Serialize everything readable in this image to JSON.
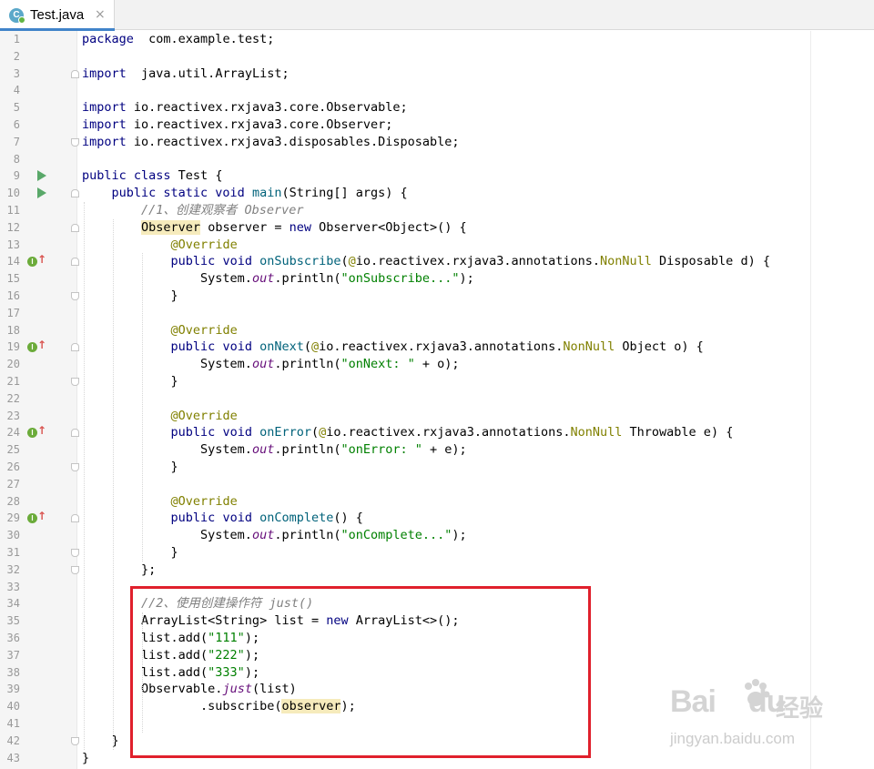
{
  "tab": {
    "title": "Test.java",
    "icon": "java-class-icon",
    "close": "×"
  },
  "lines": [
    {
      "n": "1",
      "parts": [
        [
          "kw",
          "package"
        ],
        [
          "",
          "  com.example.test;"
        ]
      ]
    },
    {
      "n": "2",
      "parts": []
    },
    {
      "n": "3",
      "parts": [
        [
          "kw",
          "import"
        ],
        [
          "",
          "  java.util.ArrayList;"
        ]
      ]
    },
    {
      "n": "4",
      "parts": []
    },
    {
      "n": "5",
      "parts": [
        [
          "kw",
          "import"
        ],
        [
          "",
          " io.reactivex.rxjava3.core.Observable;"
        ]
      ]
    },
    {
      "n": "6",
      "parts": [
        [
          "kw",
          "import"
        ],
        [
          "",
          " io.reactivex.rxjava3.core.Observer;"
        ]
      ]
    },
    {
      "n": "7",
      "parts": [
        [
          "kw",
          "import"
        ],
        [
          "",
          " io.reactivex.rxjava3.disposables.Disposable;"
        ]
      ]
    },
    {
      "n": "8",
      "parts": []
    },
    {
      "n": "9",
      "parts": [
        [
          "kw",
          "public class"
        ],
        [
          "",
          " Test {"
        ]
      ]
    },
    {
      "n": "10",
      "parts": [
        [
          "",
          "    "
        ],
        [
          "kw",
          "public static void"
        ],
        [
          "",
          " "
        ],
        [
          "fn",
          "main"
        ],
        [
          "",
          "(String[] args) {"
        ]
      ]
    },
    {
      "n": "11",
      "parts": [
        [
          "",
          "        "
        ],
        [
          "cm",
          "//1、创建观察者 Observer"
        ]
      ]
    },
    {
      "n": "12",
      "parts": [
        [
          "",
          "        "
        ],
        [
          "hl",
          "Observer"
        ],
        [
          "",
          " observer = "
        ],
        [
          "kw",
          "new"
        ],
        [
          "",
          " Observer<Object>() {"
        ]
      ]
    },
    {
      "n": "13",
      "parts": [
        [
          "",
          "            "
        ],
        [
          "ann",
          "@Override"
        ]
      ]
    },
    {
      "n": "14",
      "parts": [
        [
          "",
          "            "
        ],
        [
          "kw",
          "public void"
        ],
        [
          "",
          " "
        ],
        [
          "fn",
          "onSubscribe"
        ],
        [
          "",
          "("
        ],
        [
          "ann",
          "@"
        ],
        [
          "",
          "io.reactivex.rxjava3.annotations."
        ],
        [
          "ann",
          "NonNull"
        ],
        [
          "",
          " Disposable d) {"
        ]
      ]
    },
    {
      "n": "15",
      "parts": [
        [
          "",
          "                System."
        ],
        [
          "st",
          "out"
        ],
        [
          "",
          ".println("
        ],
        [
          "str",
          "\"onSubscribe...\""
        ],
        [
          "",
          ");"
        ]
      ]
    },
    {
      "n": "16",
      "parts": [
        [
          "",
          "            }"
        ]
      ]
    },
    {
      "n": "17",
      "parts": []
    },
    {
      "n": "18",
      "parts": [
        [
          "",
          "            "
        ],
        [
          "ann",
          "@Override"
        ]
      ]
    },
    {
      "n": "19",
      "parts": [
        [
          "",
          "            "
        ],
        [
          "kw",
          "public void"
        ],
        [
          "",
          " "
        ],
        [
          "fn",
          "onNext"
        ],
        [
          "",
          "("
        ],
        [
          "ann",
          "@"
        ],
        [
          "",
          "io.reactivex.rxjava3.annotations."
        ],
        [
          "ann",
          "NonNull"
        ],
        [
          "",
          " Object o) {"
        ]
      ]
    },
    {
      "n": "20",
      "parts": [
        [
          "",
          "                System."
        ],
        [
          "st",
          "out"
        ],
        [
          "",
          ".println("
        ],
        [
          "str",
          "\"onNext: \""
        ],
        [
          "",
          " + o);"
        ]
      ]
    },
    {
      "n": "21",
      "parts": [
        [
          "",
          "            }"
        ]
      ]
    },
    {
      "n": "22",
      "parts": []
    },
    {
      "n": "23",
      "parts": [
        [
          "",
          "            "
        ],
        [
          "ann",
          "@Override"
        ]
      ]
    },
    {
      "n": "24",
      "parts": [
        [
          "",
          "            "
        ],
        [
          "kw",
          "public void"
        ],
        [
          "",
          " "
        ],
        [
          "fn",
          "onError"
        ],
        [
          "",
          "("
        ],
        [
          "ann",
          "@"
        ],
        [
          "",
          "io.reactivex.rxjava3.annotations."
        ],
        [
          "ann",
          "NonNull"
        ],
        [
          "",
          " Throwable e) {"
        ]
      ]
    },
    {
      "n": "25",
      "parts": [
        [
          "",
          "                System."
        ],
        [
          "st",
          "out"
        ],
        [
          "",
          ".println("
        ],
        [
          "str",
          "\"onError: \""
        ],
        [
          "",
          " + e);"
        ]
      ]
    },
    {
      "n": "26",
      "parts": [
        [
          "",
          "            }"
        ]
      ]
    },
    {
      "n": "27",
      "parts": []
    },
    {
      "n": "28",
      "parts": [
        [
          "",
          "            "
        ],
        [
          "ann",
          "@Override"
        ]
      ]
    },
    {
      "n": "29",
      "parts": [
        [
          "",
          "            "
        ],
        [
          "kw",
          "public void"
        ],
        [
          "",
          " "
        ],
        [
          "fn",
          "onComplete"
        ],
        [
          "",
          "() {"
        ]
      ]
    },
    {
      "n": "30",
      "parts": [
        [
          "",
          "                System."
        ],
        [
          "st",
          "out"
        ],
        [
          "",
          ".println("
        ],
        [
          "str",
          "\"onComplete...\""
        ],
        [
          "",
          ");"
        ]
      ]
    },
    {
      "n": "31",
      "parts": [
        [
          "",
          "            }"
        ]
      ]
    },
    {
      "n": "32",
      "parts": [
        [
          "",
          "        };"
        ]
      ]
    },
    {
      "n": "33",
      "parts": []
    },
    {
      "n": "34",
      "parts": [
        [
          "",
          "        "
        ],
        [
          "cm",
          "//2、使用创建操作符 just()"
        ]
      ]
    },
    {
      "n": "35",
      "parts": [
        [
          "",
          "        ArrayList<String> list = "
        ],
        [
          "kw",
          "new"
        ],
        [
          "",
          " ArrayList<>();"
        ]
      ]
    },
    {
      "n": "36",
      "parts": [
        [
          "",
          "        list.add("
        ],
        [
          "str",
          "\"111\""
        ],
        [
          "",
          ");"
        ]
      ]
    },
    {
      "n": "37",
      "parts": [
        [
          "",
          "        list.add("
        ],
        [
          "str",
          "\"222\""
        ],
        [
          "",
          ");"
        ]
      ]
    },
    {
      "n": "38",
      "parts": [
        [
          "",
          "        list.add("
        ],
        [
          "str",
          "\"333\""
        ],
        [
          "",
          ");"
        ]
      ]
    },
    {
      "n": "39",
      "parts": [
        [
          "",
          "        Observable."
        ],
        [
          "st",
          "just"
        ],
        [
          "",
          "(list)"
        ]
      ]
    },
    {
      "n": "40",
      "parts": [
        [
          "",
          "                .subscribe("
        ],
        [
          "hl",
          "observer"
        ],
        [
          "",
          ");"
        ]
      ]
    },
    {
      "n": "41",
      "parts": []
    },
    {
      "n": "42",
      "parts": [
        [
          "",
          "    }"
        ]
      ]
    },
    {
      "n": "43",
      "parts": [
        [
          "",
          "}"
        ]
      ]
    }
  ],
  "gutter_markers": {
    "run": [
      "9",
      "10"
    ],
    "implements": [
      "14",
      "19",
      "24",
      "29"
    ],
    "fold_start": [
      "3",
      "10",
      "12",
      "14",
      "19",
      "24",
      "29"
    ],
    "fold_end": [
      "7",
      "16",
      "21",
      "26",
      "31",
      "32",
      "42"
    ]
  },
  "highlight_box": {
    "color": "#e0202c",
    "from_line": "34",
    "to_line": "42"
  },
  "watermark": {
    "brand": "Bai",
    "brand2": "du",
    "cn": "经验",
    "url": "jingyan.baidu.com"
  }
}
